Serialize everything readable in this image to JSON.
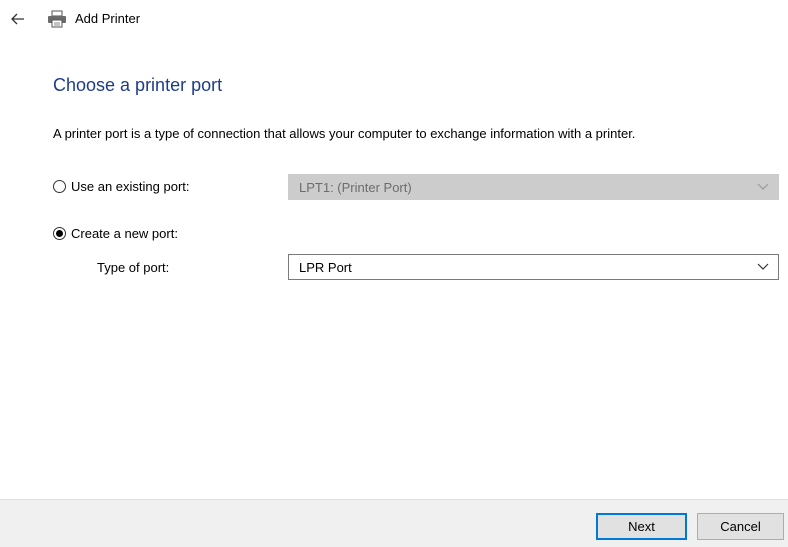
{
  "window": {
    "title": "Add Printer",
    "back_icon": "back-arrow-icon",
    "app_icon": "printer-icon"
  },
  "page": {
    "heading": "Choose a printer port",
    "description": "A printer port is a type of connection that allows your computer to exchange information with a printer."
  },
  "options": {
    "existing_port": {
      "label": "Use an existing port:",
      "selected": false,
      "value": "LPT1: (Printer Port)",
      "enabled": false
    },
    "new_port": {
      "label": "Create a new port:",
      "selected": true
    },
    "type_of_port": {
      "label": "Type of port:",
      "value": "LPR Port"
    }
  },
  "buttons": {
    "next": "Next",
    "cancel": "Cancel"
  },
  "colors": {
    "heading": "#1e3c8c",
    "accent": "#0078d7",
    "disabled_bg": "#cccccc",
    "footer_bg": "#f0f0f0"
  }
}
